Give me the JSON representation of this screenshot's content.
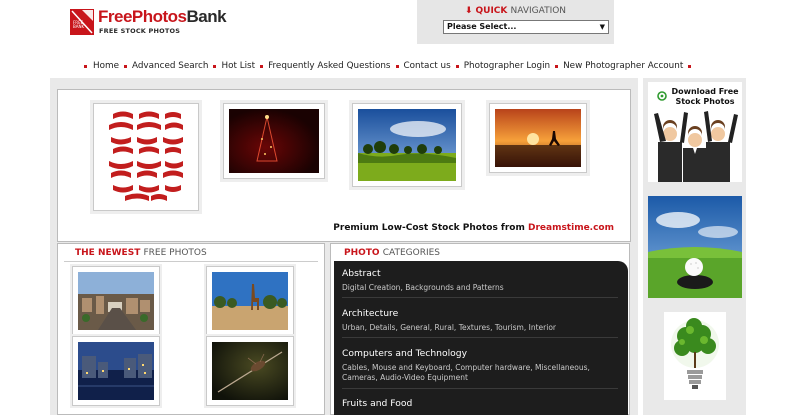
{
  "header": {
    "logo": {
      "brand_part1": "FreePhotos",
      "brand_part2": "Bank",
      "tagline": "FREE STOCK PHOTOS",
      "mark_text": "FREE BANK"
    },
    "quick_nav": {
      "title_part1": "QUICK",
      "title_part2": "NAVIGATION",
      "select_value": "Please Select..."
    },
    "nav": [
      "Home",
      "Advanced Search",
      "Hot List",
      "Frequently Asked Questions",
      "Contact us",
      "Photographer Login",
      "New Photographer Account"
    ]
  },
  "banner": {
    "caption_prefix": "Premium Low-Cost Stock Photos from ",
    "caption_link": "Dreamstime.com"
  },
  "newest": {
    "title_part1": "THE NEWEST",
    "title_part2": "FREE PHOTOS"
  },
  "categories": {
    "title_part1": "PHOTO",
    "title_part2": "CATEGORIES",
    "items": [
      {
        "name": "Abstract",
        "desc": "Digital Creation, Backgrounds and Patterns"
      },
      {
        "name": "Architecture",
        "desc": "Urban, Details, General, Rural, Textures, Tourism, Interior"
      },
      {
        "name": "Computers and Technology",
        "desc": "Cables, Mouse and Keyboard, Computer hardware, Miscellaneous, Cameras, Audio-Video Equipment"
      },
      {
        "name": "Fruits and Food",
        "desc": ""
      }
    ]
  },
  "sidebar": {
    "download_ad": "Download Free Stock Photos"
  },
  "colors": {
    "accent": "#c8151b",
    "panel_dark": "#1d1d1d",
    "background_gray": "#e9e9e9"
  }
}
